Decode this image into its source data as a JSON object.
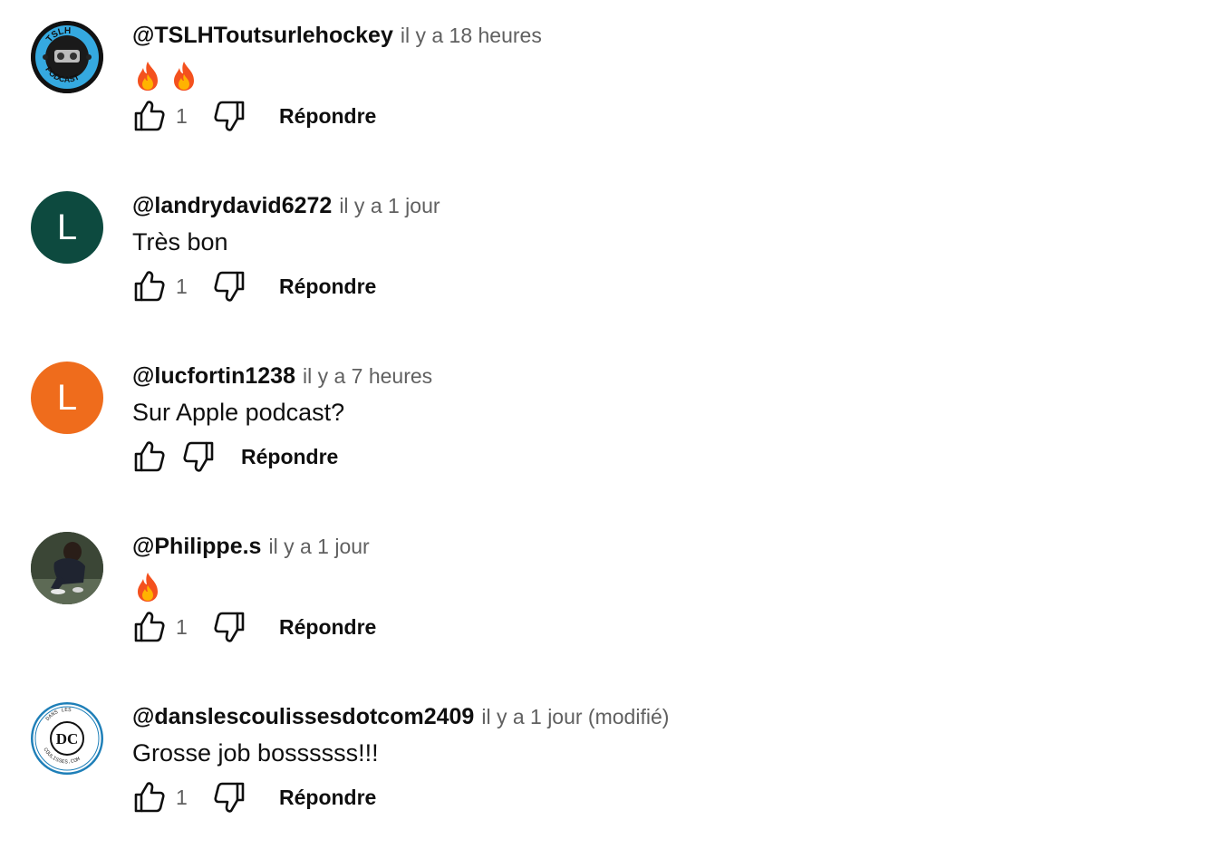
{
  "comments": [
    {
      "author": "@TSLHToutsurlehockey",
      "time": "il y a 18 heures",
      "body": "",
      "emoji_count": 2,
      "emoji_icon": "fire-emoji",
      "likes": "1",
      "reply_label": "Répondre",
      "avatar": {
        "type": "logo",
        "text": "TSLH PODCAST",
        "bg": "#1b1b1b",
        "ring": "#35a9e0"
      }
    },
    {
      "author": "@landrydavid6272",
      "time": "il y a 1 jour",
      "body": "Très bon",
      "likes": "1",
      "reply_label": "Répondre",
      "avatar": {
        "type": "letter",
        "letter": "L",
        "bg": "#0d4a3f"
      }
    },
    {
      "author": "@lucfortin1238",
      "time": "il y a 7 heures",
      "body": "Sur Apple podcast?",
      "likes": "",
      "reply_label": "Répondre",
      "avatar": {
        "type": "letter",
        "letter": "L",
        "bg": "#ef6c1c"
      }
    },
    {
      "author": "@Philippe.s",
      "time": "il y a 1 jour",
      "body": "",
      "emoji_count": 1,
      "emoji_icon": "fire-emoji",
      "likes": "1",
      "reply_label": "Répondre",
      "avatar": {
        "type": "photo",
        "bg": "#2e3a2a"
      }
    },
    {
      "author": "@danslescoulissesdotcom2409",
      "time": "il y a 1 jour (modifié)",
      "body": "Grosse job bossssss!!!",
      "likes": "1",
      "reply_label": "Répondre",
      "avatar": {
        "type": "logo",
        "text": "DANS LES COULISSES.COM",
        "bg": "#ffffff",
        "ring": "#1e7fb8"
      }
    }
  ],
  "icons": {
    "like": "thumbs-up-icon",
    "dislike": "thumbs-down-icon"
  },
  "colors": {
    "text_primary": "#0f0f0f",
    "text_secondary": "#606060"
  }
}
